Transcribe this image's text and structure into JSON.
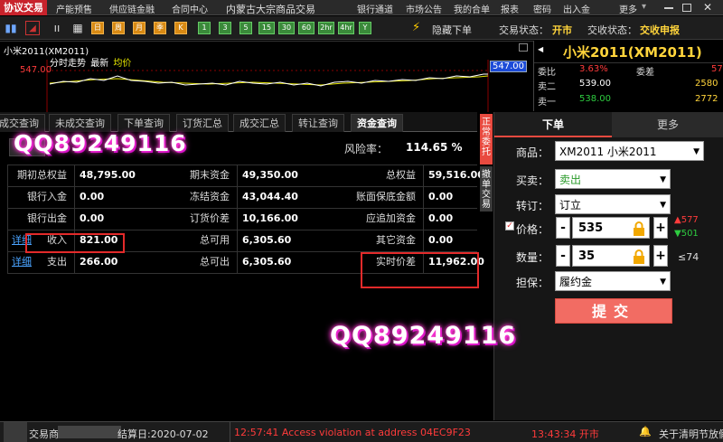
{
  "menubar": {
    "active": "协议交易",
    "items": [
      "产能预售",
      "供应链金融",
      "合同中心",
      "内蒙古大宗商品交易",
      "银行通道",
      "市场公告",
      "我的合单",
      "报表",
      "密码",
      "出入金",
      "更多"
    ]
  },
  "toolbar": {
    "period_buttons": [
      "日",
      "周",
      "月",
      "季",
      "K",
      "1",
      "3",
      "5",
      "15",
      "30",
      "60",
      "2hr",
      "4hr",
      "Y"
    ],
    "hide_order": "隐藏下单",
    "trade_status_label": "交易状态：",
    "trade_status_value": "开市",
    "collect_status_label": "交收状态：",
    "collect_status_value": "交收申报"
  },
  "chart": {
    "instrument": "小米2011(XM2011)",
    "legend_trend": "分时走势",
    "legend_latest": "最新",
    "legend_avg": "均价",
    "left_price": "547.00",
    "right_price": "547.00",
    "colors": {
      "price_line": "#ffffff",
      "avg_line": "#e6e600",
      "grid": "#8b0000",
      "axis_label": "#ff3b3b"
    }
  },
  "quote": {
    "title": "小米2011(XM2011)",
    "rows": [
      {
        "label": "委比",
        "value": "3.63%",
        "label2": "委差",
        "value2": "57"
      },
      {
        "label": "卖二",
        "value": "539.00",
        "value2": "2580"
      },
      {
        "label": "卖一",
        "value": "538.00",
        "value2": "2772"
      }
    ]
  },
  "tabs": [
    "成交查询",
    "未成交查询",
    "下单查询",
    "订货汇总",
    "成交汇总",
    "转让查询",
    "资金查询"
  ],
  "funds": {
    "risk_label": "风险率：",
    "risk_value": "114.65 %",
    "rows": [
      [
        {
          "l": "期初总权益",
          "v": "48,795.00"
        },
        {
          "l": "期末资金",
          "v": "49,350.00"
        },
        {
          "l": "总权益",
          "v": "59,516.00"
        }
      ],
      [
        {
          "l": "银行入金",
          "v": "0.00"
        },
        {
          "l": "冻结资金",
          "v": "43,044.40"
        },
        {
          "l": "账面保底金额",
          "v": "0.00"
        }
      ],
      [
        {
          "l": "银行出金",
          "v": "0.00"
        },
        {
          "l": "订货价差",
          "v": "10,166.00"
        },
        {
          "l": "应追加资金",
          "v": "0.00"
        }
      ],
      [
        {
          "l": "收入",
          "v": "821.00",
          "link": "详细"
        },
        {
          "l": "总可用",
          "v": "6,305.60"
        },
        {
          "l": "其它资金",
          "v": "0.00"
        }
      ],
      [
        {
          "l": "支出",
          "v": "266.00",
          "link": "详细"
        },
        {
          "l": "总可出",
          "v": "6,305.60"
        },
        {
          "l": "实时价差",
          "v": "11,962.00"
        }
      ]
    ]
  },
  "side_tabs": {
    "top": "正常委托",
    "bottom": "撤单交易"
  },
  "order": {
    "tab_order": "下单",
    "tab_more": "更多",
    "product_label": "商品：",
    "product_value": "XM2011 小米2011",
    "side_label": "买卖：",
    "side_value": "卖出",
    "open_label": "转订：",
    "open_value": "订立",
    "price_label": "价格：",
    "price_value": "535",
    "price_up": "577",
    "price_down": "501",
    "qty_label": "数量：",
    "qty_value": "35",
    "qty_max": "≤74",
    "margin_label": "担保：",
    "margin_value": "履约金",
    "submit": "提交"
  },
  "status": {
    "trader_label": "交易商:",
    "settle_date": "结算日:2020-07-02",
    "error_msg": "12:57:41 Access violation at address 04EC9F23",
    "clock": "13:43:34 开市",
    "about": "关于清明节放假"
  },
  "watermark": {
    "text1": "QQ89249116",
    "text2": "QQ89249116"
  }
}
